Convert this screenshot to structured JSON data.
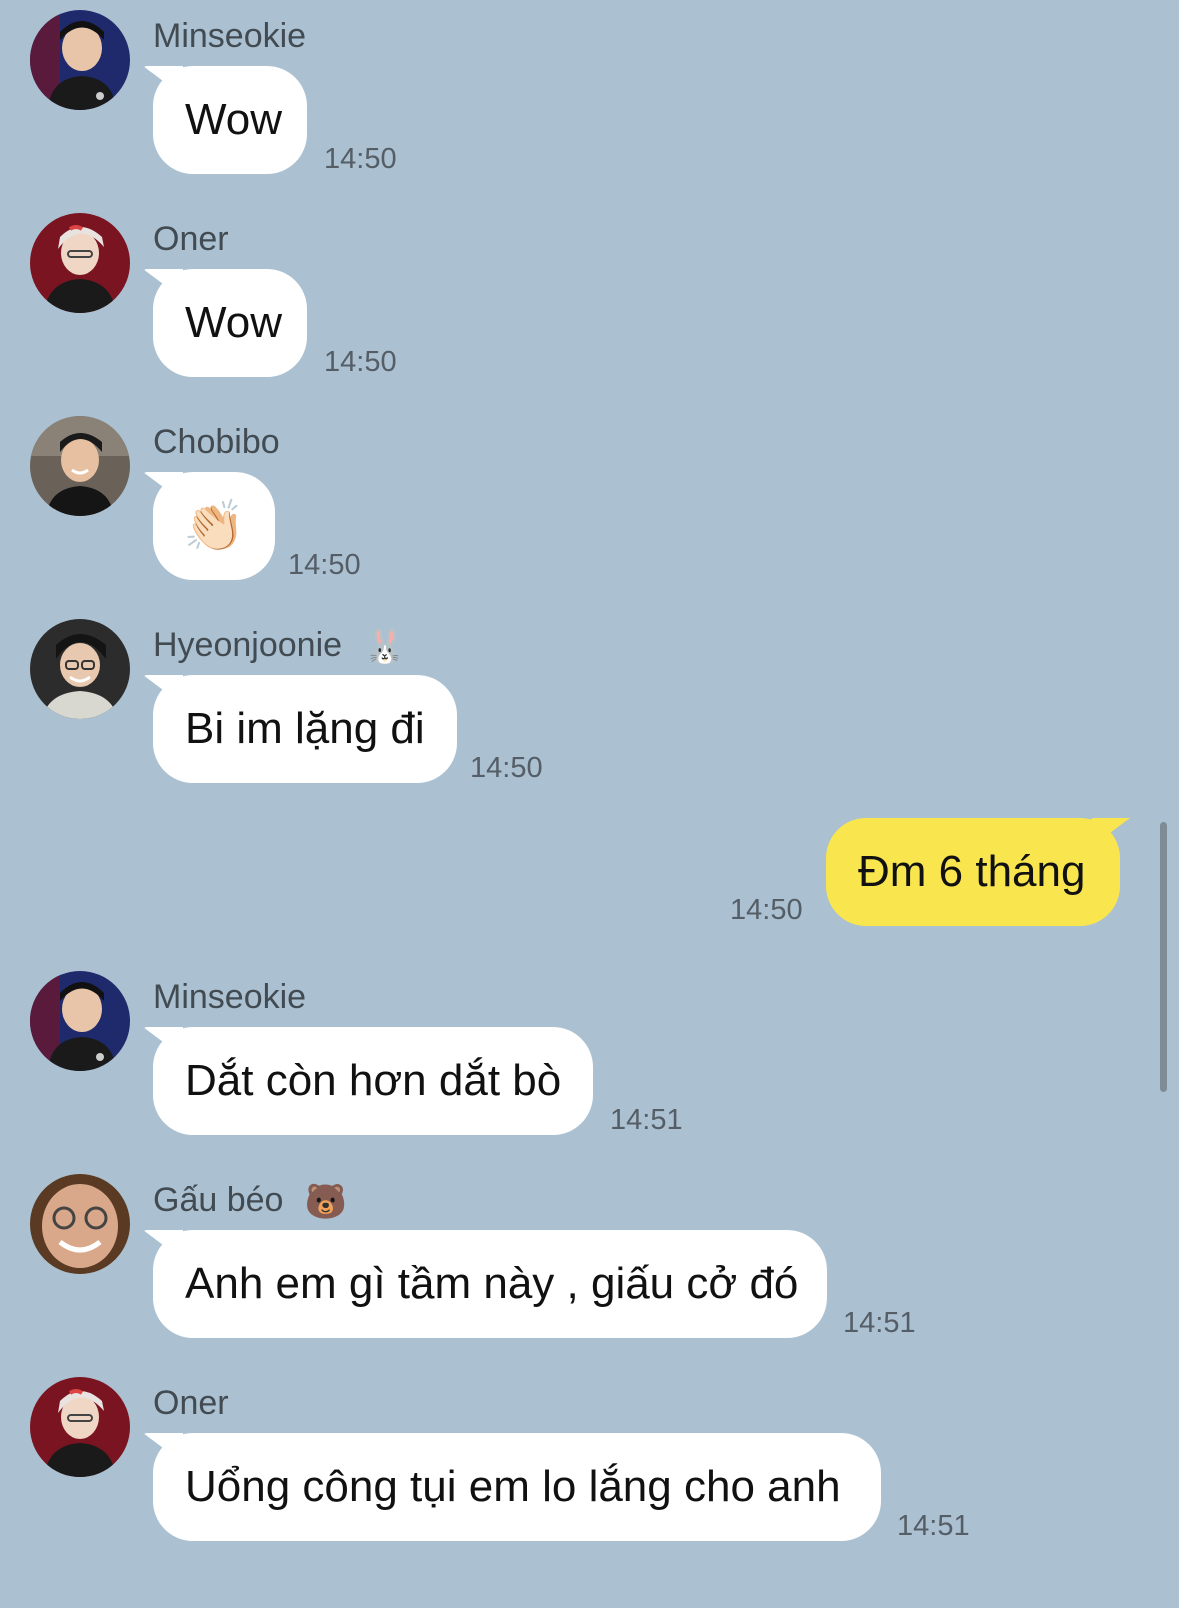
{
  "messages": [
    {
      "sender": "Minseokie",
      "sender_emoji": "",
      "text": "Wow",
      "time": "14:50",
      "is_mine": false,
      "avatar_color": "#1e2a6b"
    },
    {
      "sender": "Oner",
      "sender_emoji": "",
      "text": "Wow",
      "time": "14:50",
      "is_mine": false,
      "avatar_color": "#7a1420"
    },
    {
      "sender": "Chobibo",
      "sender_emoji": "",
      "text": "👏🏻",
      "time": "14:50",
      "is_mine": false,
      "avatar_color": "#6a6258"
    },
    {
      "sender": "Hyeonjoonie",
      "sender_emoji": "🐰",
      "text": "Bi im lặng đi",
      "time": "14:50",
      "is_mine": false,
      "avatar_color": "#2c2c2c"
    },
    {
      "sender": "",
      "sender_emoji": "",
      "text": "Đm 6 tháng",
      "time": "14:50",
      "is_mine": true
    },
    {
      "sender": "Minseokie",
      "sender_emoji": "",
      "text": "Dắt còn hơn dắt bò",
      "time": "14:51",
      "is_mine": false,
      "avatar_color": "#1e2a6b"
    },
    {
      "sender": "Gấu béo",
      "sender_emoji": "🐻",
      "text": "Anh em gì tầm này , giấu cở đó",
      "time": "14:51",
      "is_mine": false,
      "avatar_color": "#5a3a22"
    },
    {
      "sender": "Oner",
      "sender_emoji": "",
      "text": "Uổng công tụi em lo lắng cho anh",
      "time": "14:51",
      "is_mine": false,
      "avatar_color": "#7a1420"
    }
  ]
}
